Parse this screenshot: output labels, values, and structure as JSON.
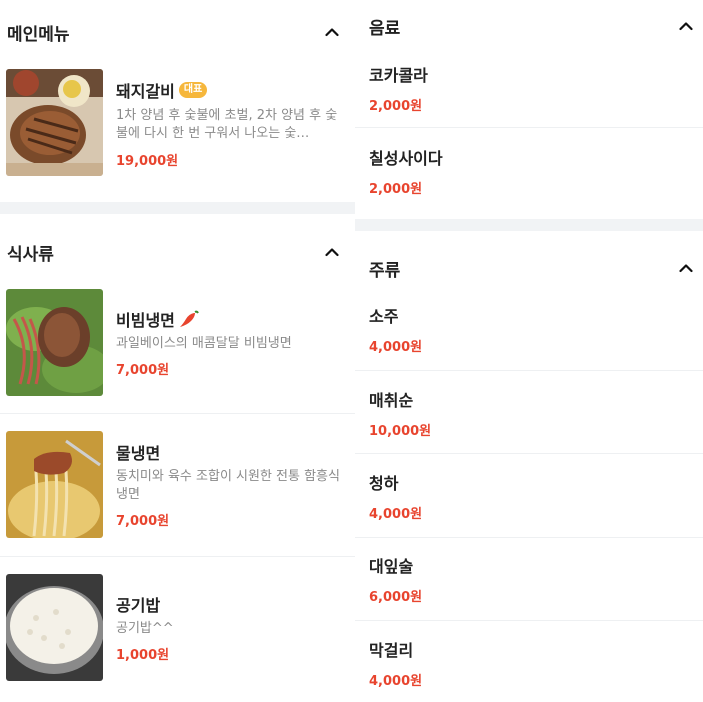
{
  "left": {
    "main_menu": {
      "title": "메인메뉴",
      "items": [
        {
          "name": "돼지갈비",
          "badge": "대표",
          "desc": "1차 양념 후 숯불에 초벌, 2차 양념 후 숯불에 다시 한 번 구워서 나오는 숯…",
          "price": "19,000원"
        }
      ]
    },
    "meals": {
      "title": "식사류",
      "items": [
        {
          "name": "비빔냉면",
          "icon": "chili-pepper-icon",
          "desc": "과일베이스의 매콤달달 비빔냉면",
          "price": "7,000원"
        },
        {
          "name": "물냉면",
          "desc": "동치미와 육수 조합이 시원한 전통 함흥식 냉면",
          "price": "7,000원"
        },
        {
          "name": "공기밥",
          "desc": "공기밥^^",
          "price": "1,000원"
        }
      ]
    }
  },
  "right": {
    "drinks": {
      "title": "음료",
      "items": [
        {
          "name": "코카콜라",
          "price": "2,000원"
        },
        {
          "name": "칠성사이다",
          "price": "2,000원"
        }
      ]
    },
    "alcohol": {
      "title": "주류",
      "items": [
        {
          "name": "소주",
          "price": "4,000원"
        },
        {
          "name": "매취순",
          "price": "10,000원"
        },
        {
          "name": "청하",
          "price": "4,000원"
        },
        {
          "name": "대잎술",
          "price": "6,000원"
        },
        {
          "name": "막걸리",
          "price": "4,000원"
        }
      ]
    }
  },
  "icons": {
    "section_toggle": "chevron-up-icon"
  },
  "colors": {
    "price": "#e8442e",
    "badge": "#f6b73c",
    "section_gap": "#f1f3f5"
  }
}
